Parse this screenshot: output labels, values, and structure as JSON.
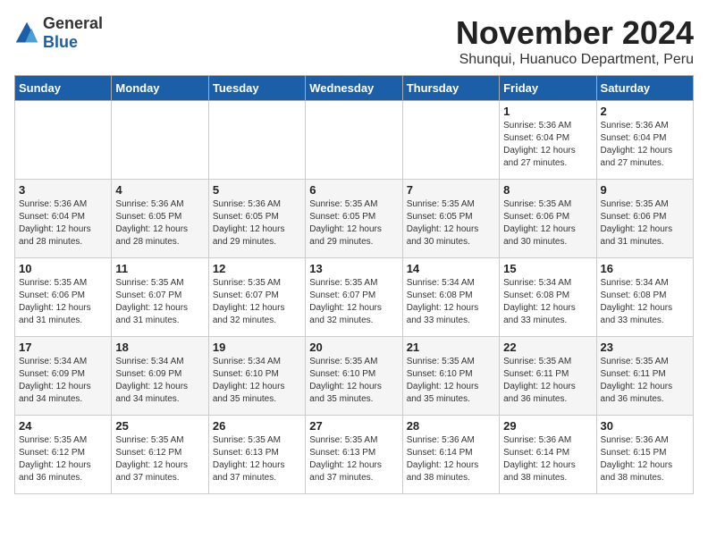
{
  "header": {
    "logo_general": "General",
    "logo_blue": "Blue",
    "month_title": "November 2024",
    "location": "Shunqui, Huanuco Department, Peru"
  },
  "weekdays": [
    "Sunday",
    "Monday",
    "Tuesday",
    "Wednesday",
    "Thursday",
    "Friday",
    "Saturday"
  ],
  "weeks": [
    [
      {
        "day": "",
        "info": ""
      },
      {
        "day": "",
        "info": ""
      },
      {
        "day": "",
        "info": ""
      },
      {
        "day": "",
        "info": ""
      },
      {
        "day": "",
        "info": ""
      },
      {
        "day": "1",
        "info": "Sunrise: 5:36 AM\nSunset: 6:04 PM\nDaylight: 12 hours and 27 minutes."
      },
      {
        "day": "2",
        "info": "Sunrise: 5:36 AM\nSunset: 6:04 PM\nDaylight: 12 hours and 27 minutes."
      }
    ],
    [
      {
        "day": "3",
        "info": "Sunrise: 5:36 AM\nSunset: 6:04 PM\nDaylight: 12 hours and 28 minutes."
      },
      {
        "day": "4",
        "info": "Sunrise: 5:36 AM\nSunset: 6:05 PM\nDaylight: 12 hours and 28 minutes."
      },
      {
        "day": "5",
        "info": "Sunrise: 5:36 AM\nSunset: 6:05 PM\nDaylight: 12 hours and 29 minutes."
      },
      {
        "day": "6",
        "info": "Sunrise: 5:35 AM\nSunset: 6:05 PM\nDaylight: 12 hours and 29 minutes."
      },
      {
        "day": "7",
        "info": "Sunrise: 5:35 AM\nSunset: 6:05 PM\nDaylight: 12 hours and 30 minutes."
      },
      {
        "day": "8",
        "info": "Sunrise: 5:35 AM\nSunset: 6:06 PM\nDaylight: 12 hours and 30 minutes."
      },
      {
        "day": "9",
        "info": "Sunrise: 5:35 AM\nSunset: 6:06 PM\nDaylight: 12 hours and 31 minutes."
      }
    ],
    [
      {
        "day": "10",
        "info": "Sunrise: 5:35 AM\nSunset: 6:06 PM\nDaylight: 12 hours and 31 minutes."
      },
      {
        "day": "11",
        "info": "Sunrise: 5:35 AM\nSunset: 6:07 PM\nDaylight: 12 hours and 31 minutes."
      },
      {
        "day": "12",
        "info": "Sunrise: 5:35 AM\nSunset: 6:07 PM\nDaylight: 12 hours and 32 minutes."
      },
      {
        "day": "13",
        "info": "Sunrise: 5:35 AM\nSunset: 6:07 PM\nDaylight: 12 hours and 32 minutes."
      },
      {
        "day": "14",
        "info": "Sunrise: 5:34 AM\nSunset: 6:08 PM\nDaylight: 12 hours and 33 minutes."
      },
      {
        "day": "15",
        "info": "Sunrise: 5:34 AM\nSunset: 6:08 PM\nDaylight: 12 hours and 33 minutes."
      },
      {
        "day": "16",
        "info": "Sunrise: 5:34 AM\nSunset: 6:08 PM\nDaylight: 12 hours and 33 minutes."
      }
    ],
    [
      {
        "day": "17",
        "info": "Sunrise: 5:34 AM\nSunset: 6:09 PM\nDaylight: 12 hours and 34 minutes."
      },
      {
        "day": "18",
        "info": "Sunrise: 5:34 AM\nSunset: 6:09 PM\nDaylight: 12 hours and 34 minutes."
      },
      {
        "day": "19",
        "info": "Sunrise: 5:34 AM\nSunset: 6:10 PM\nDaylight: 12 hours and 35 minutes."
      },
      {
        "day": "20",
        "info": "Sunrise: 5:35 AM\nSunset: 6:10 PM\nDaylight: 12 hours and 35 minutes."
      },
      {
        "day": "21",
        "info": "Sunrise: 5:35 AM\nSunset: 6:10 PM\nDaylight: 12 hours and 35 minutes."
      },
      {
        "day": "22",
        "info": "Sunrise: 5:35 AM\nSunset: 6:11 PM\nDaylight: 12 hours and 36 minutes."
      },
      {
        "day": "23",
        "info": "Sunrise: 5:35 AM\nSunset: 6:11 PM\nDaylight: 12 hours and 36 minutes."
      }
    ],
    [
      {
        "day": "24",
        "info": "Sunrise: 5:35 AM\nSunset: 6:12 PM\nDaylight: 12 hours and 36 minutes."
      },
      {
        "day": "25",
        "info": "Sunrise: 5:35 AM\nSunset: 6:12 PM\nDaylight: 12 hours and 37 minutes."
      },
      {
        "day": "26",
        "info": "Sunrise: 5:35 AM\nSunset: 6:13 PM\nDaylight: 12 hours and 37 minutes."
      },
      {
        "day": "27",
        "info": "Sunrise: 5:35 AM\nSunset: 6:13 PM\nDaylight: 12 hours and 37 minutes."
      },
      {
        "day": "28",
        "info": "Sunrise: 5:36 AM\nSunset: 6:14 PM\nDaylight: 12 hours and 38 minutes."
      },
      {
        "day": "29",
        "info": "Sunrise: 5:36 AM\nSunset: 6:14 PM\nDaylight: 12 hours and 38 minutes."
      },
      {
        "day": "30",
        "info": "Sunrise: 5:36 AM\nSunset: 6:15 PM\nDaylight: 12 hours and 38 minutes."
      }
    ]
  ]
}
